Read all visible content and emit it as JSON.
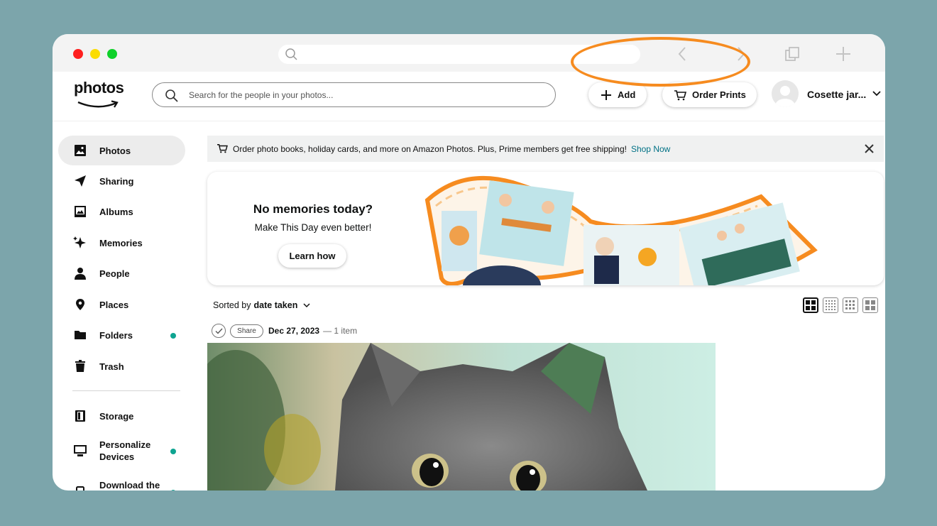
{
  "browser": {
    "search_placeholder": ""
  },
  "header": {
    "logo_text": "photos",
    "search_placeholder": "Search for the people in your photos...",
    "add_label": "Add",
    "order_prints_label": "Order Prints",
    "user_name": "Cosette jar..."
  },
  "sidebar": {
    "items": [
      {
        "label": "Photos",
        "icon": "photo-icon",
        "active": true
      },
      {
        "label": "Sharing",
        "icon": "send-icon"
      },
      {
        "label": "Albums",
        "icon": "album-icon"
      },
      {
        "label": "Memories",
        "icon": "sparkle-icon"
      },
      {
        "label": "People",
        "icon": "person-icon"
      },
      {
        "label": "Places",
        "icon": "location-pin-icon"
      },
      {
        "label": "Folders",
        "icon": "folder-icon",
        "dot": true
      },
      {
        "label": "Trash",
        "icon": "trash-icon"
      },
      {
        "label": "Storage",
        "icon": "storage-icon"
      },
      {
        "label": "Personalize Devices",
        "icon": "monitor-icon",
        "dot": true
      },
      {
        "label": "Download the",
        "icon": "phone-icon",
        "dot": true
      }
    ]
  },
  "banner": {
    "message": "Order photo books, holiday cards, and more on Amazon Photos. Plus, Prime members get free shipping!",
    "link": "Shop Now"
  },
  "memories": {
    "title": "No memories today?",
    "subtitle": "Make This Day even better!",
    "button": "Learn how"
  },
  "sort": {
    "prefix": "Sorted by",
    "value": "date taken"
  },
  "group": {
    "share_label": "Share",
    "date": "Dec 27, 2023",
    "count": "— 1 item"
  },
  "colors": {
    "accent_orange": "#f68b1f",
    "link_teal": "#007185",
    "dot_teal": "#0ea491",
    "background": "#7ca5ab"
  }
}
